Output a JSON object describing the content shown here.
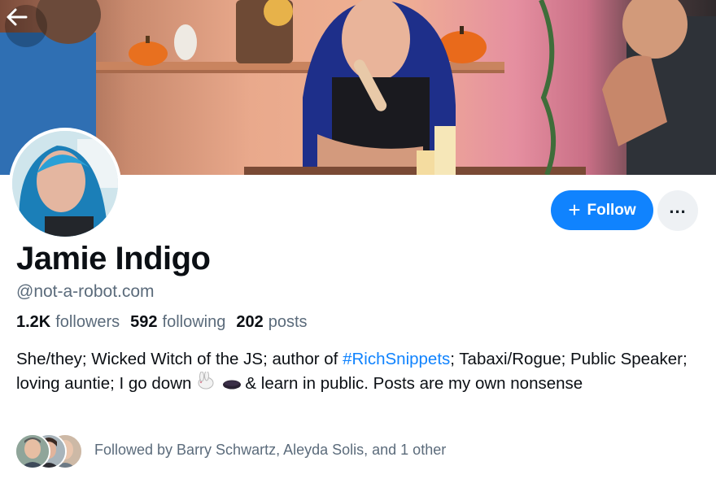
{
  "profile": {
    "display_name": "Jamie Indigo",
    "handle": "@not-a-robot.com",
    "stats": [
      {
        "count": "1.2K",
        "label": "followers"
      },
      {
        "count": "592",
        "label": "following"
      },
      {
        "count": "202",
        "label": "posts"
      }
    ],
    "bio": {
      "part1": "She/they; Wicked Witch of the JS; author of ",
      "hashtag": "#RichSnippets",
      "part2": "; Tabaxi/Rogue; Public Speaker; loving auntie; I go down",
      "part3": "& learn in public. Posts are my own nonsense"
    },
    "followed_by": "Followed by Barry Schwartz, Aleyda Solis, and 1 other"
  },
  "actions": {
    "follow_label": "Follow",
    "follow_plus": "+",
    "more_label": "..."
  },
  "icons": {
    "back": "arrow-left-icon",
    "plus": "plus-icon",
    "more": "ellipsis-icon",
    "emoji_1": "rabbit-emoji",
    "emoji_2": "hole-emoji"
  },
  "colors": {
    "accent": "#1083fe",
    "muted_text": "#5b6b7b",
    "secondary_button": "#eef1f4"
  }
}
